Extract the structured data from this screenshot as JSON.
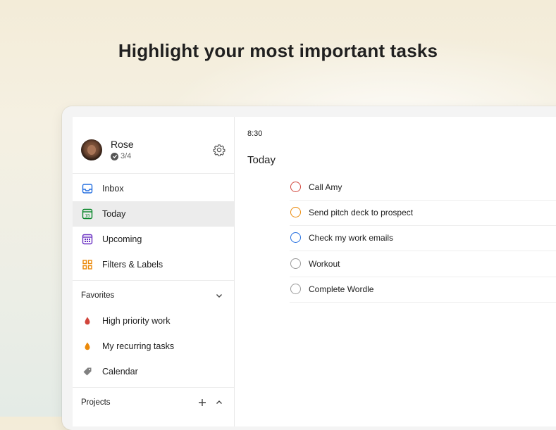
{
  "headline": "Highlight your most important tasks",
  "user": {
    "name": "Rose",
    "karma": "3/4"
  },
  "nav": [
    {
      "label": "Inbox",
      "icon": "inbox-icon",
      "color": "#246fe0"
    },
    {
      "label": "Today",
      "icon": "calendar-today-icon",
      "color": "#058527"
    },
    {
      "label": "Upcoming",
      "icon": "calendar-upcoming-icon",
      "color": "#692fc2"
    },
    {
      "label": "Filters & Labels",
      "icon": "filters-labels-icon",
      "color": "#eb8909"
    }
  ],
  "favorites": {
    "title": "Favorites",
    "items": [
      {
        "label": "High priority work",
        "icon": "drop-icon",
        "color": "#d1453b"
      },
      {
        "label": "My recurring tasks",
        "icon": "drop-icon",
        "color": "#eb8909"
      },
      {
        "label": "Calendar",
        "icon": "label-tag-icon",
        "color": "#808080"
      }
    ]
  },
  "projects": {
    "title": "Projects"
  },
  "main": {
    "time": "8:30",
    "title": "Today",
    "tasks": [
      {
        "label": "Call Amy",
        "priority_color": "#d1453b"
      },
      {
        "label": "Send pitch deck to prospect",
        "priority_color": "#eb8909"
      },
      {
        "label": "Check my work emails",
        "priority_color": "#246fe0"
      },
      {
        "label": "Workout",
        "priority_color": "#999999"
      },
      {
        "label": "Complete Wordle",
        "priority_color": "#999999"
      }
    ]
  }
}
